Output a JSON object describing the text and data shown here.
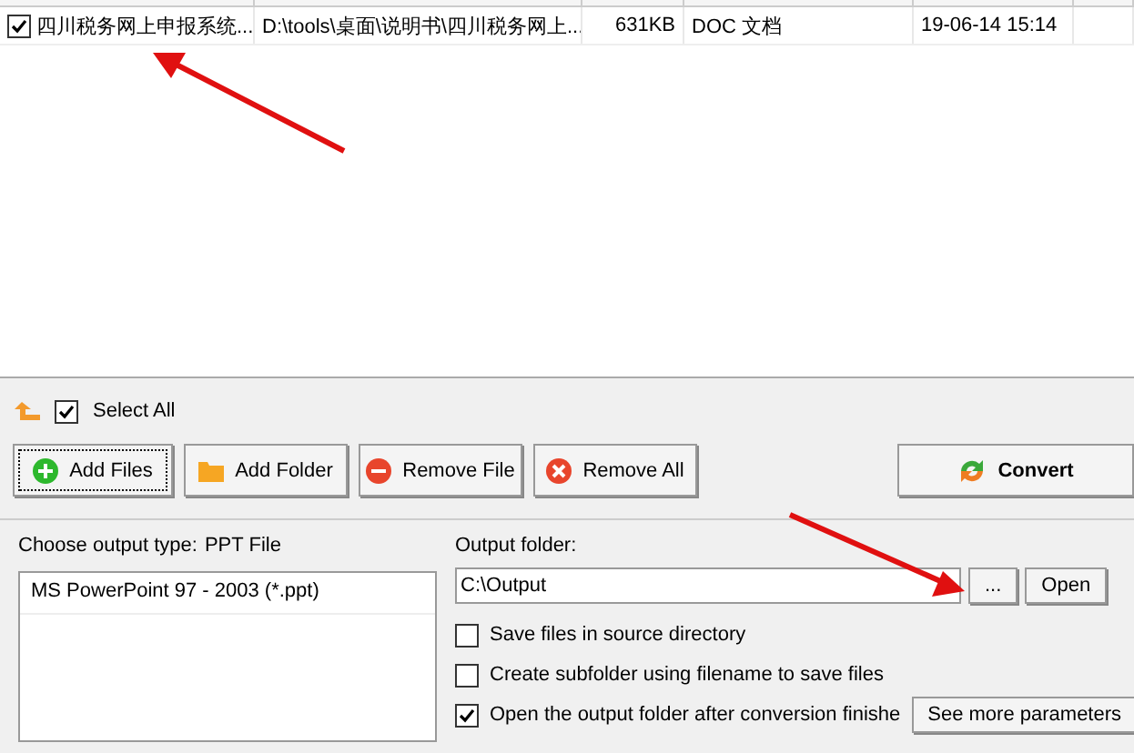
{
  "table": {
    "rows": [
      {
        "checked": true,
        "cells": [
          "四川税务网上申报系统...",
          "D:\\tools\\桌面\\说明书\\四川税务网上...",
          "631KB",
          "DOC 文档",
          "19-06-14 15:14"
        ]
      }
    ]
  },
  "select_all": {
    "label": "Select All",
    "checked": true
  },
  "buttons": [
    {
      "kind": "add",
      "label": "Add Files",
      "focused": true
    },
    {
      "kind": "folder",
      "label": "Add Folder",
      "focused": false
    },
    {
      "kind": "remove",
      "label": "Remove File",
      "focused": false
    },
    {
      "kind": "clear",
      "label": "Remove All",
      "focused": false
    }
  ],
  "convert": {
    "label": "Convert"
  },
  "output_type": {
    "label": "Choose output type:",
    "value": "PPT File",
    "formats": [
      "MS PowerPoint 97 - 2003 (*.ppt)"
    ]
  },
  "output_folder": {
    "label": "Output folder:",
    "value": "C:\\Output",
    "browse": "...",
    "open": "Open"
  },
  "options": [
    {
      "label": "Save files in source directory",
      "checked": false
    },
    {
      "label": "Create subfolder using filename to save files",
      "checked": false
    },
    {
      "label": "Open the output folder after conversion finishe",
      "checked": true
    }
  ],
  "more_button": {
    "label": "See more parameters"
  }
}
